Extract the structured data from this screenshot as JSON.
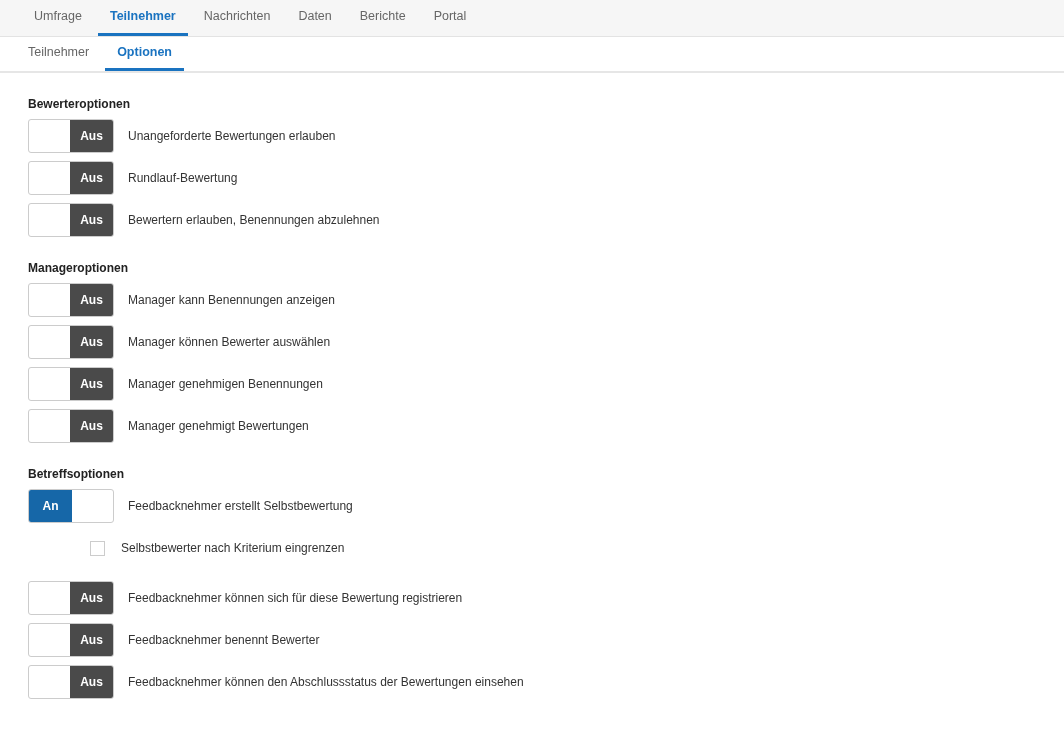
{
  "main_tabs": [
    {
      "label": "Umfrage",
      "selected": false
    },
    {
      "label": "Teilnehmer",
      "selected": true
    },
    {
      "label": "Nachrichten",
      "selected": false
    },
    {
      "label": "Daten",
      "selected": false
    },
    {
      "label": "Berichte",
      "selected": false
    },
    {
      "label": "Portal",
      "selected": false
    }
  ],
  "sub_tabs": [
    {
      "label": "Teilnehmer",
      "selected": false
    },
    {
      "label": "Optionen",
      "selected": true
    }
  ],
  "sections": [
    {
      "title": "Bewerteroptionen",
      "options": [
        {
          "kind": "toggle",
          "on": false,
          "state_label": "Aus",
          "label": "Unangeforderte Bewertungen erlauben"
        },
        {
          "kind": "toggle",
          "on": false,
          "state_label": "Aus",
          "label": "Rundlauf-Bewertung"
        },
        {
          "kind": "toggle",
          "on": false,
          "state_label": "Aus",
          "label": "Bewertern erlauben, Benennungen abzulehnen"
        }
      ]
    },
    {
      "title": "Manageroptionen",
      "options": [
        {
          "kind": "toggle",
          "on": false,
          "state_label": "Aus",
          "label": "Manager kann Benennungen anzeigen"
        },
        {
          "kind": "toggle",
          "on": false,
          "state_label": "Aus",
          "label": "Manager können Bewerter auswählen"
        },
        {
          "kind": "toggle",
          "on": false,
          "state_label": "Aus",
          "label": "Manager genehmigen Benennungen"
        },
        {
          "kind": "toggle",
          "on": false,
          "state_label": "Aus",
          "label": "Manager genehmigt Bewertungen"
        }
      ]
    },
    {
      "title": "Betreffsoptionen",
      "options": [
        {
          "kind": "toggle",
          "on": true,
          "state_label": "An",
          "label": "Feedbacknehmer erstellt Selbstbewertung"
        },
        {
          "kind": "checkbox",
          "checked": false,
          "label": "Selbstbewerter nach Kriterium eingrenzen"
        },
        {
          "kind": "toggle",
          "on": false,
          "state_label": "Aus",
          "label": "Feedbacknehmer können sich für diese Bewertung registrieren"
        },
        {
          "kind": "toggle",
          "on": false,
          "state_label": "Aus",
          "label": "Feedbacknehmer benennt Bewerter"
        },
        {
          "kind": "toggle",
          "on": false,
          "state_label": "Aus",
          "label": "Feedbacknehmer können den Abschlussstatus der Bewertungen einsehen"
        }
      ]
    }
  ]
}
